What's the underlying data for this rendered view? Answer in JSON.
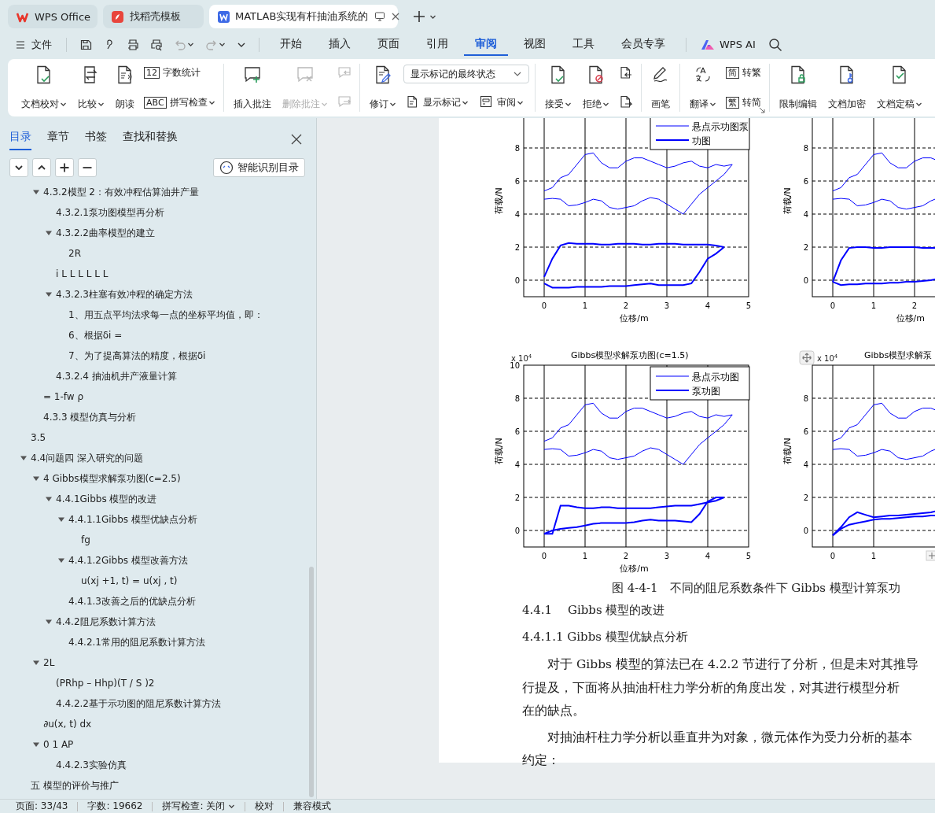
{
  "title_bar": {
    "tabs": [
      {
        "label": "WPS Office",
        "selected": false
      },
      {
        "label": "找稻壳模板",
        "selected": false
      },
      {
        "label": "MATLAB实现有杆抽油系统的",
        "selected": true
      }
    ]
  },
  "menu_bar": {
    "file": "文件",
    "tabs": [
      {
        "label": "开始",
        "selected": false
      },
      {
        "label": "插入",
        "selected": false
      },
      {
        "label": "页面",
        "selected": false
      },
      {
        "label": "引用",
        "selected": false
      },
      {
        "label": "审阅",
        "selected": true
      },
      {
        "label": "视图",
        "selected": false
      },
      {
        "label": "工具",
        "selected": false
      },
      {
        "label": "会员专享",
        "selected": false
      }
    ],
    "ai": "WPS AI"
  },
  "ribbon": {
    "groups": [
      {
        "columns": [
          {
            "kind": "large",
            "label": "文档校对",
            "dropdown": true,
            "disabled": false
          },
          {
            "kind": "large",
            "label": "比较",
            "dropdown": true,
            "disabled": false
          },
          {
            "kind": "large",
            "label": "朗读",
            "dropdown": false,
            "disabled": false
          },
          {
            "kind": "stack",
            "rows": [
              [
                {
                  "kind": "small",
                  "glyph": "12",
                  "label": "字数统计",
                  "dropdown": false,
                  "disabled": false
                }
              ],
              [
                {
                  "kind": "small",
                  "glyph": "ABC",
                  "label": "拼写检查",
                  "dropdown": true,
                  "disabled": false
                }
              ]
            ]
          }
        ]
      },
      {
        "columns": [
          {
            "kind": "large",
            "label": "插入批注",
            "dropdown": false,
            "disabled": false
          },
          {
            "kind": "large",
            "label": "删除批注",
            "dropdown": true,
            "disabled": true
          },
          {
            "kind": "stack",
            "rows": [
              [
                {
                  "kind": "icon",
                  "disabled": true
                }
              ],
              [
                {
                  "kind": "icon",
                  "disabled": true
                }
              ]
            ]
          }
        ]
      },
      {
        "columns": [
          {
            "kind": "large",
            "label": "修订",
            "dropdown": true,
            "disabled": false
          },
          {
            "kind": "stack",
            "rows": [
              [
                {
                  "kind": "select",
                  "value": "显示标记的最终状态"
                }
              ],
              [
                {
                  "kind": "small",
                  "label": "显示标记",
                  "dropdown": true,
                  "disabled": false
                },
                {
                  "kind": "small",
                  "label": "审阅",
                  "dropdown": true,
                  "disabled": false
                }
              ]
            ]
          }
        ]
      },
      {
        "columns": [
          {
            "kind": "large",
            "label": "接受",
            "dropdown": true,
            "disabled": false
          },
          {
            "kind": "large",
            "label": "拒绝",
            "dropdown": true,
            "disabled": false
          },
          {
            "kind": "stack",
            "rows": [
              [
                {
                  "kind": "icon",
                  "disabled": false
                }
              ],
              [
                {
                  "kind": "icon",
                  "disabled": false
                }
              ]
            ]
          }
        ]
      },
      {
        "columns": [
          {
            "kind": "large",
            "label": "画笔",
            "dropdown": false,
            "disabled": false
          }
        ]
      },
      {
        "columns": [
          {
            "kind": "large",
            "label": "翻译",
            "dropdown": true,
            "disabled": false
          },
          {
            "kind": "stack",
            "rows": [
              [
                {
                  "kind": "small",
                  "glyph": "简",
                  "label": "转繁",
                  "dropdown": false,
                  "disabled": false
                }
              ],
              [
                {
                  "kind": "small",
                  "glyph": "繁",
                  "label": "转简",
                  "dropdown": false,
                  "disabled": false
                }
              ]
            ]
          }
        ]
      },
      {
        "columns": [
          {
            "kind": "large",
            "label": "限制编辑",
            "dropdown": false,
            "disabled": false
          },
          {
            "kind": "large",
            "label": "文档加密",
            "dropdown": false,
            "disabled": false
          },
          {
            "kind": "large",
            "label": "文档定稿",
            "dropdown": true,
            "disabled": false
          }
        ]
      }
    ]
  },
  "sidebar": {
    "tabs": [
      {
        "label": "目录",
        "selected": true
      },
      {
        "label": "章节",
        "selected": false
      },
      {
        "label": "书签",
        "selected": false
      },
      {
        "label": "查找和替换",
        "selected": false
      }
    ],
    "smart_button": "智能识别目录",
    "toc": {
      "continued": [
        {
          "label": "4.3.2模型 2：有效冲程估算油井产量",
          "expanded": true,
          "children": [
            {
              "label": "4.3.2.1泵功图模型再分析"
            },
            {
              "label": "4.3.2.2曲率模型的建立",
              "expanded": true,
              "children": [
                {
                  "label": "2R"
                }
              ]
            },
            {
              "label": "i L   L L L L L"
            },
            {
              "label": "4.3.2.3柱塞有效冲程的确定方法",
              "expanded": true,
              "children": [
                {
                  "label": "1、用五点平均法求每一点的坐标平均值，即："
                },
                {
                  "label": "6、根据δi ="
                },
                {
                  "label": "7、为了提高算法的精度，根据δi"
                }
              ]
            },
            {
              "label": "4.3.2.4 抽油机井产液量计算"
            }
          ]
        },
        {
          "label": "= 1-fw ρ"
        },
        {
          "label": "4.3.3 模型仿真与分析"
        }
      ],
      "items": [
        {
          "label": "3.5"
        },
        {
          "label": "4.4问题四 深入研究的问题",
          "expanded": true,
          "children": [
            {
              "label": "4 Gibbs模型求解泵功图(c=2.5)",
              "expanded": true,
              "children": [
                {
                  "label": "4.4.1Gibbs 模型的改进",
                  "expanded": true,
                  "children": [
                    {
                      "label": "4.4.1.1Gibbs 模型优缺点分析",
                      "expanded": true,
                      "children": [
                        {
                          "label": "fg"
                        }
                      ]
                    },
                    {
                      "label": "4.4.1.2Gibbs 模型改善方法",
                      "expanded": true,
                      "children": [
                        {
                          "label": "u(xj +1, t) = u(xj , t)"
                        }
                      ]
                    },
                    {
                      "label": "4.4.1.3改善之后的优缺点分析"
                    }
                  ]
                },
                {
                  "label": "4.4.2阻尼系数计算方法",
                  "expanded": true,
                  "children": [
                    {
                      "label": "4.4.2.1常用的阻尼系数计算方法"
                    }
                  ]
                }
              ]
            },
            {
              "label": "2L",
              "expanded": true,
              "children": [
                {
                  "label": "(PRhp – Hhp)(T / S )2"
                },
                {
                  "label": "4.4.2.2基于示功图的阻尼系数计算方法"
                }
              ]
            },
            {
              "label": "∂u(x, t) dx"
            },
            {
              "label": "0  1   AP",
              "expanded": true,
              "children": [
                {
                  "label": "4.4.2.3实验仿真"
                }
              ]
            }
          ]
        },
        {
          "label": "五 模型的评价与推广"
        }
      ]
    }
  },
  "document": {
    "charts": [
      {
        "chart_data": {
          "type": "line",
          "grid": true,
          "legend": "upper right",
          "xlabel": "位移/m",
          "ylabel": "荷载/N",
          "xlim": [
            -0.5,
            5
          ],
          "ylim": [
            -1,
            10
          ],
          "xticks": [
            0,
            1,
            2,
            3,
            4,
            5
          ],
          "yticks": [
            0,
            2,
            4,
            6,
            8
          ],
          "x": [
            0,
            0.2,
            0.4,
            0.6,
            0.8,
            1.0,
            1.2,
            1.4,
            1.6,
            1.8,
            2.0,
            2.2,
            2.4,
            2.6,
            2.8,
            3.0,
            3.2,
            3.4,
            3.6,
            3.8,
            4.0,
            4.2,
            4.4,
            4.6
          ],
          "series": [
            {
              "name": "悬点示功图泵",
              "color": "#0000ff",
              "values": [
                5.4,
                5.6,
                6.2,
                6.4,
                7.0,
                7.6,
                7.7,
                7.1,
                6.8,
                6.8,
                7.2,
                7.4,
                7.4,
                7.2,
                7.0,
                6.8,
                6.9,
                7.1,
                7.2,
                6.9,
                6.8,
                7.0,
                6.9,
                7.0
              ]
            },
            {
              "color": "#0000ff",
              "values": [
                4.9,
                4.95,
                4.9,
                4.5,
                4.55,
                4.7,
                4.9,
                4.8,
                4.4,
                4.3,
                4.4,
                4.5,
                4.8,
                5.0,
                4.9,
                4.6,
                4.3,
                4.0,
                4.6,
                5.2,
                5.6,
                6.0,
                6.4,
                7.0
              ]
            },
            {
              "name": "功图",
              "color": "#0000ff",
              "values": [
                0.2,
                1.3,
                2.1,
                2.25,
                2.2,
                2.2,
                2.2,
                2.15,
                2.15,
                2.2,
                2.2,
                2.2,
                2.15,
                2.15,
                2.2,
                2.2,
                2.2,
                2.15,
                2.15,
                2.15,
                2.15,
                2.1,
                2.0,
                null
              ]
            },
            {
              "color": "#0000ff",
              "values": [
                -0.2,
                -0.45,
                -0.45,
                -0.45,
                -0.4,
                -0.4,
                -0.4,
                -0.4,
                -0.35,
                -0.35,
                -0.35,
                -0.3,
                -0.25,
                -0.2,
                -0.3,
                -0.3,
                -0.3,
                -0.3,
                -0.2,
                0.5,
                1.3,
                1.6,
                2.0,
                null
              ]
            }
          ]
        }
      },
      {
        "chart_data": {
          "type": "line",
          "grid": true,
          "xlabel": "位移/m",
          "ylabel": "荷载/N",
          "xlim": [
            -0.5,
            5
          ],
          "ylim": [
            -1,
            10
          ],
          "xticks": [
            0,
            1,
            2
          ],
          "yticks": [
            0,
            2,
            4,
            6,
            8
          ],
          "x": [
            0,
            0.2,
            0.4,
            0.6,
            0.8,
            1.0,
            1.2,
            1.4,
            1.6,
            1.8,
            2.0,
            2.2,
            2.4,
            2.6
          ],
          "series": [
            {
              "color": "#0000ff",
              "values": [
                5.4,
                5.6,
                6.2,
                6.4,
                7.0,
                7.6,
                7.7,
                7.1,
                6.8,
                6.8,
                7.2,
                7.4,
                7.4,
                7.2
              ]
            },
            {
              "color": "#0000ff",
              "values": [
                4.9,
                4.95,
                4.9,
                4.5,
                4.55,
                4.7,
                4.9,
                4.8,
                4.4,
                4.3,
                4.4,
                4.5,
                4.8,
                5.0
              ]
            },
            {
              "color": "#0000ff",
              "values": [
                -0.1,
                1.2,
                1.95,
                2.0,
                2.0,
                1.95,
                1.95,
                2.0,
                2.0,
                2.0,
                2.0,
                1.95,
                1.95,
                1.95
              ]
            },
            {
              "color": "#0000ff",
              "values": [
                -0.1,
                -0.3,
                -0.25,
                -0.25,
                -0.2,
                -0.2,
                -0.2,
                -0.15,
                -0.15,
                -0.1,
                -0.1,
                -0.05,
                0.0,
                0.1
              ]
            }
          ]
        }
      },
      {
        "chart_data": {
          "type": "line",
          "grid": true,
          "legend": "upper right",
          "title": "Gibbs模型求解泵功图(c=1.5)",
          "annotations": [
            {
              "text": "x 10$^{4}$"
            }
          ],
          "xlabel": "位移/m",
          "ylabel": "荷载/N",
          "xlim": [
            -0.5,
            5
          ],
          "ylim": [
            -1,
            10
          ],
          "xticks": [
            0,
            1,
            2,
            3,
            4,
            5
          ],
          "yticks": [
            0,
            2,
            4,
            6,
            8,
            10
          ],
          "x": [
            0,
            0.2,
            0.4,
            0.6,
            0.8,
            1.0,
            1.2,
            1.4,
            1.6,
            1.8,
            2.0,
            2.2,
            2.4,
            2.6,
            2.8,
            3.0,
            3.2,
            3.4,
            3.6,
            3.8,
            4.0,
            4.2,
            4.4,
            4.6
          ],
          "series": [
            {
              "name": "悬点示功图",
              "color": "#0000ff",
              "values": [
                5.4,
                5.6,
                6.2,
                6.4,
                7.0,
                7.6,
                7.7,
                7.1,
                6.8,
                6.8,
                7.2,
                7.4,
                7.4,
                7.2,
                7.0,
                6.8,
                6.9,
                7.1,
                7.2,
                6.9,
                6.8,
                7.0,
                6.9,
                7.0
              ]
            },
            {
              "color": "#0000ff",
              "values": [
                4.9,
                4.95,
                4.9,
                4.5,
                4.55,
                4.7,
                4.9,
                4.8,
                4.4,
                4.3,
                4.4,
                4.5,
                4.8,
                5.0,
                4.9,
                4.6,
                4.3,
                4.0,
                4.6,
                5.2,
                5.6,
                6.0,
                6.4,
                7.0
              ]
            },
            {
              "name": "泵功图",
              "color": "#0000ff",
              "values": [
                -0.2,
                -0.2,
                1.5,
                1.5,
                1.4,
                1.35,
                1.35,
                1.4,
                1.4,
                1.35,
                1.35,
                1.35,
                1.35,
                1.35,
                1.4,
                1.45,
                1.5,
                1.5,
                1.5,
                1.6,
                1.7,
                1.8,
                2.0,
                null
              ]
            },
            {
              "color": "#0000ff",
              "values": [
                -0.2,
                0.0,
                0.1,
                0.15,
                0.2,
                0.3,
                0.4,
                0.45,
                0.45,
                0.45,
                0.45,
                0.5,
                0.6,
                0.65,
                0.6,
                0.6,
                0.6,
                0.55,
                0.5,
                1.0,
                1.75,
                2.0,
                2.0,
                null
              ]
            }
          ]
        }
      },
      {
        "chart_data": {
          "type": "line",
          "grid": true,
          "title": "Gibbs模型求解泵",
          "annotations": [
            {
              "text": "x 10$^{4}$"
            }
          ],
          "ylabel": "荷载/N",
          "xlim": [
            -0.5,
            5
          ],
          "ylim": [
            -1,
            10
          ],
          "xticks": [
            0,
            1
          ],
          "yticks": [
            0,
            2,
            4,
            6,
            8
          ],
          "x": [
            0,
            0.2,
            0.4,
            0.6,
            0.8,
            1.0,
            1.2,
            1.4,
            1.6,
            1.8,
            2.0,
            2.2,
            2.4,
            2.6
          ],
          "series": [
            {
              "color": "#0000ff",
              "values": [
                5.4,
                5.6,
                6.2,
                6.4,
                7.0,
                7.6,
                7.7,
                7.1,
                6.8,
                6.8,
                7.2,
                7.4,
                7.4,
                7.2
              ]
            },
            {
              "color": "#0000ff",
              "values": [
                4.9,
                4.95,
                4.9,
                4.5,
                4.55,
                4.7,
                4.9,
                4.8,
                4.4,
                4.3,
                4.4,
                4.5,
                4.8,
                5.0
              ]
            },
            {
              "color": "#0000ff",
              "values": [
                -0.3,
                0.2,
                0.8,
                1.1,
                0.95,
                0.8,
                0.85,
                0.9,
                0.9,
                0.95,
                1.0,
                1.05,
                1.1,
                1.2
              ]
            },
            {
              "color": "#0000ff",
              "values": [
                -0.3,
                0.1,
                0.35,
                0.45,
                0.55,
                0.65,
                0.7,
                0.7,
                0.75,
                0.8,
                0.85,
                0.85,
                0.9,
                0.9
              ]
            }
          ]
        }
      }
    ],
    "caption": "图 4-4-1　不同的阻尼系数条件下 Gibbs 模型计算泵功",
    "headings": [
      "4.4.1　 Gibbs 模型的改进",
      "4.4.1.1 Gibbs 模型优缺点分析"
    ],
    "paragraphs": [
      [
        "对于 Gibbs 模型的算法已在 4.2.2 节进行了分析，但是未对其推导",
        "行提及，下面将从抽油杆柱力学分析的角度出发，对其进行模型分析",
        "在的缺点。"
      ],
      [
        "对抽油杆柱力学分析以垂直井为对象，微元体作为受力分析的基本",
        "约定："
      ]
    ]
  },
  "status_bar": {
    "page": "页面: 33/43",
    "words": "字数: 19662",
    "spell": "拼写检查: 关闭",
    "proof": "校对",
    "mode": "兼容模式"
  }
}
